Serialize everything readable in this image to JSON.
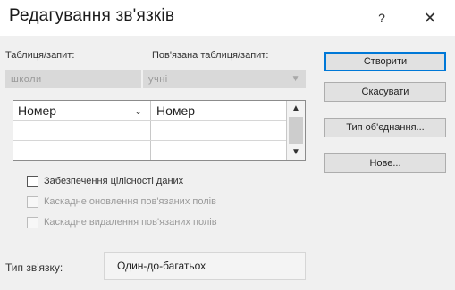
{
  "dialog": {
    "title": "Редагування зв'язків",
    "help_glyph": "?",
    "close_glyph": "✕"
  },
  "table_query": {
    "label": "Таблиця/запит:",
    "value": "школи"
  },
  "related_table_query": {
    "label": "Пов'язана таблиця/запит:",
    "value": "учні"
  },
  "field_grid": {
    "rows": [
      {
        "left": "Номер",
        "right": "Номер"
      },
      {
        "left": "",
        "right": ""
      },
      {
        "left": "",
        "right": ""
      }
    ]
  },
  "options": {
    "enforce_integrity": {
      "label": "Забезпечення цілісності даних",
      "checked": false
    },
    "cascade_update": {
      "label": "Каскадне оновлення пов'язаних полів",
      "checked": false,
      "enabled": false
    },
    "cascade_delete": {
      "label": "Каскадне видалення пов'язаних полів",
      "checked": false,
      "enabled": false
    }
  },
  "buttons": {
    "create": "Створити",
    "cancel": "Скасувати",
    "join_type": "Тип об'єднання...",
    "new": "Нове..."
  },
  "relationship_type": {
    "label": "Тип зв'язку:",
    "value": "Один-до-багатьох"
  }
}
